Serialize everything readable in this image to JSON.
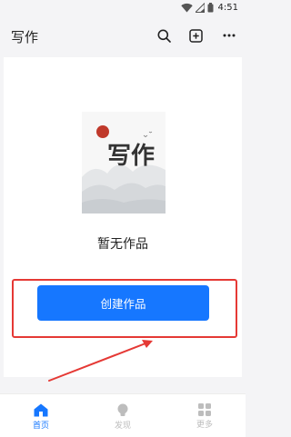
{
  "status_bar": {
    "time": "4:51"
  },
  "app_bar": {
    "title": "写作"
  },
  "empty_state": {
    "message": "暂无作品",
    "cover_text": "写作"
  },
  "create_button": {
    "label": "创建作品"
  },
  "bottom_nav": {
    "items": [
      {
        "label": "首页",
        "active": true
      },
      {
        "label": "发现",
        "active": false
      },
      {
        "label": "更多",
        "active": false
      }
    ]
  },
  "colors": {
    "accent": "#1677ff",
    "annotation_red": "#e53935",
    "inactive": "#bdbdbd",
    "background": "#f4f4f6"
  }
}
